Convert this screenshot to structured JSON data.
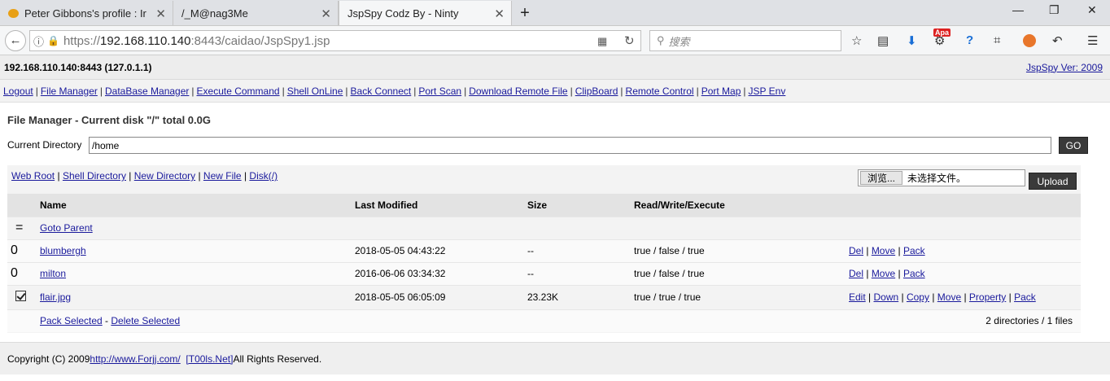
{
  "browser": {
    "tabs": [
      {
        "label": "Peter Gibbons's profile : Ir"
      },
      {
        "label": "/_M@nag3Me"
      },
      {
        "label": "JspSpy Codz By - Ninty"
      }
    ],
    "url_prefix": "https://",
    "url_host": "192.168.110.140",
    "url_rest": ":8443/caidao/JspSpy1.jsp",
    "search_placeholder": "搜索",
    "apa_badge": "Apa"
  },
  "header": {
    "host": "192.168.110.140:8443 (127.0.1.1)",
    "version": "JspSpy Ver: 2009"
  },
  "menu": [
    "Logout",
    "File Manager",
    "DataBase Manager",
    "Execute Command",
    "Shell OnLine",
    "Back Connect",
    "Port Scan",
    "Download Remote File",
    "ClipBoard",
    "Remote Control",
    "Port Map",
    "JSP Env"
  ],
  "page_title": "File Manager - Current disk \"/\" total 0.0G",
  "current_dir": {
    "label": "Current Directory",
    "value": "/home",
    "go": "GO"
  },
  "quick_links": [
    "Web Root",
    "Shell Directory",
    "New Directory",
    "New File",
    "Disk(/)"
  ],
  "upload": {
    "browse": "浏览...",
    "no_file": "未选择文件。",
    "button": "Upload"
  },
  "table": {
    "headers": [
      "Name",
      "Last Modified",
      "Size",
      "Read/Write/Execute"
    ],
    "goto_parent": {
      "mark": "=",
      "label": "Goto Parent"
    },
    "rows": [
      {
        "mark": "0",
        "name": "blumbergh",
        "modified": "2018-05-05 04:43:22",
        "size": "--",
        "rwx": "true / false / true",
        "actions": [
          "Del",
          "Move",
          "Pack"
        ]
      },
      {
        "mark": "0",
        "name": "milton",
        "modified": "2016-06-06 03:34:32",
        "size": "--",
        "rwx": "true / false / true",
        "actions": [
          "Del",
          "Move",
          "Pack"
        ]
      },
      {
        "mark": "checkbox",
        "name": "flair.jpg",
        "modified": "2018-05-05 06:05:09",
        "size": "23.23K",
        "rwx": "true / true / true",
        "actions": [
          "Edit",
          "Down",
          "Copy",
          "Move",
          "Property",
          "Pack"
        ]
      }
    ],
    "pack_selected": "Pack Selected",
    "delete_selected": "Delete Selected",
    "summary": "2 directories / 1 files"
  },
  "footer": {
    "copyright": "Copyright (C) 2009 ",
    "link1": "http://www.Forjj.com/",
    "link2": "[T00ls.Net]",
    "rest": " All Rights Reserved."
  }
}
